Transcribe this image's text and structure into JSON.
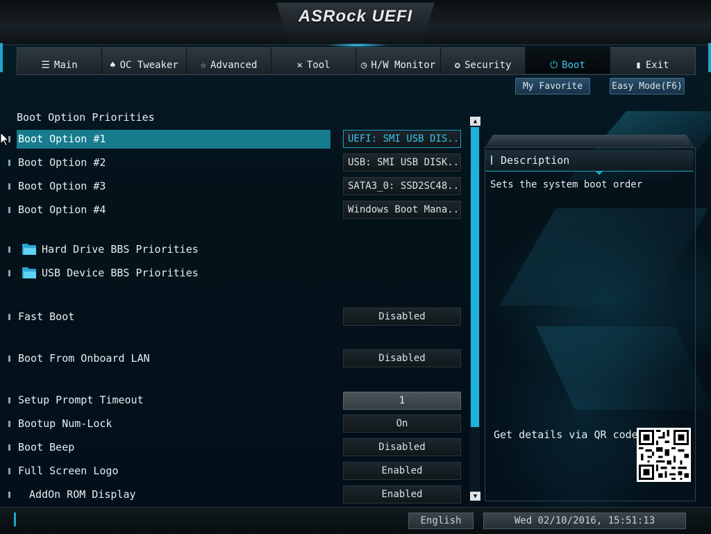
{
  "header": {
    "logo_text": "ASRock UEFI"
  },
  "tabs": [
    {
      "label": "Main",
      "icon": "list-icon",
      "active": false
    },
    {
      "label": "OC Tweaker",
      "icon": "rocket-icon",
      "active": false
    },
    {
      "label": "Advanced",
      "icon": "star-icon",
      "active": false
    },
    {
      "label": "Tool",
      "icon": "wrench-icon",
      "active": false
    },
    {
      "label": "H/W Monitor",
      "icon": "monitor-icon",
      "active": false
    },
    {
      "label": "Security",
      "icon": "shield-icon",
      "active": false
    },
    {
      "label": "Boot",
      "icon": "power-icon",
      "active": true
    },
    {
      "label": "Exit",
      "icon": "exit-icon",
      "active": false
    }
  ],
  "toolbar": {
    "favorite_label": "My Favorite",
    "easy_mode_label": "Easy Mode(F6)"
  },
  "section_title": "Boot Option Priorities",
  "settings": {
    "boot1": {
      "label": "Boot Option #1",
      "value": "UEFI: SMI USB DIS..."
    },
    "boot2": {
      "label": "Boot Option #2",
      "value": "USB: SMI USB DISK..."
    },
    "boot3": {
      "label": "Boot Option #3",
      "value": "SATA3_0: SSD2SC48..."
    },
    "boot4": {
      "label": "Boot Option #4",
      "value": "Windows Boot Mana..."
    },
    "hdd_bbs": {
      "label": "Hard Drive BBS Priorities"
    },
    "usb_bbs": {
      "label": "USB Device BBS Priorities"
    },
    "fast_boot": {
      "label": "Fast Boot",
      "value": "Disabled"
    },
    "onboard_lan": {
      "label": "Boot From Onboard LAN",
      "value": "Disabled"
    },
    "prompt_timeout": {
      "label": "Setup Prompt Timeout",
      "value": "1"
    },
    "numlock": {
      "label": "Bootup Num-Lock",
      "value": "On"
    },
    "beep": {
      "label": "Boot Beep",
      "value": "Disabled"
    },
    "logo": {
      "label": "Full Screen Logo",
      "value": "Enabled"
    },
    "addon_rom": {
      "label": "AddOn ROM Display",
      "value": "Enabled"
    }
  },
  "description": {
    "title": "Description",
    "text": "Sets the system boot order",
    "qr_label": "Get details via QR code"
  },
  "footer": {
    "language": "English",
    "datetime": "Wed 02/10/2016, 15:51:13"
  },
  "colors": {
    "accent": "#1aa7c7",
    "selection": "#167b8d",
    "active_tab_text": "#3fc8ee"
  }
}
